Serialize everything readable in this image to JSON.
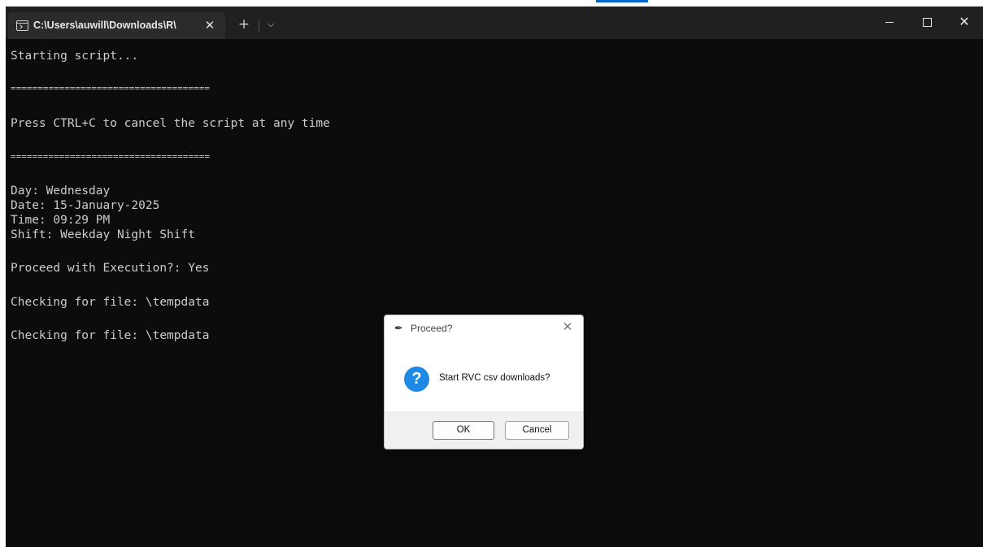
{
  "terminal": {
    "tab_title": "C:\\Users\\auwill\\Downloads\\R\\",
    "lines": [
      "Starting script...",
      "=====================================",
      "Press CTRL+C to cancel the script at any time",
      "=====================================",
      "Day: Wednesday",
      "Date: 15-January-2025",
      "Time: 09:29 PM",
      "Shift: Weekday Night Shift",
      "Proceed with Execution?: Yes",
      "Checking for file: \\tempdata",
      "Checking for file: \\tempdata"
    ]
  },
  "dialog": {
    "title": "Proceed?",
    "message": "Start RVC csv downloads?",
    "ok_label": "OK",
    "cancel_label": "Cancel"
  },
  "icons": {
    "tab_icon": "terminal-icon",
    "tab_close": "close-icon",
    "new_tab": "plus-icon",
    "dropdown": "chevron-down-icon",
    "dialog_app": "feather-icon",
    "dialog_question": "question-icon"
  }
}
